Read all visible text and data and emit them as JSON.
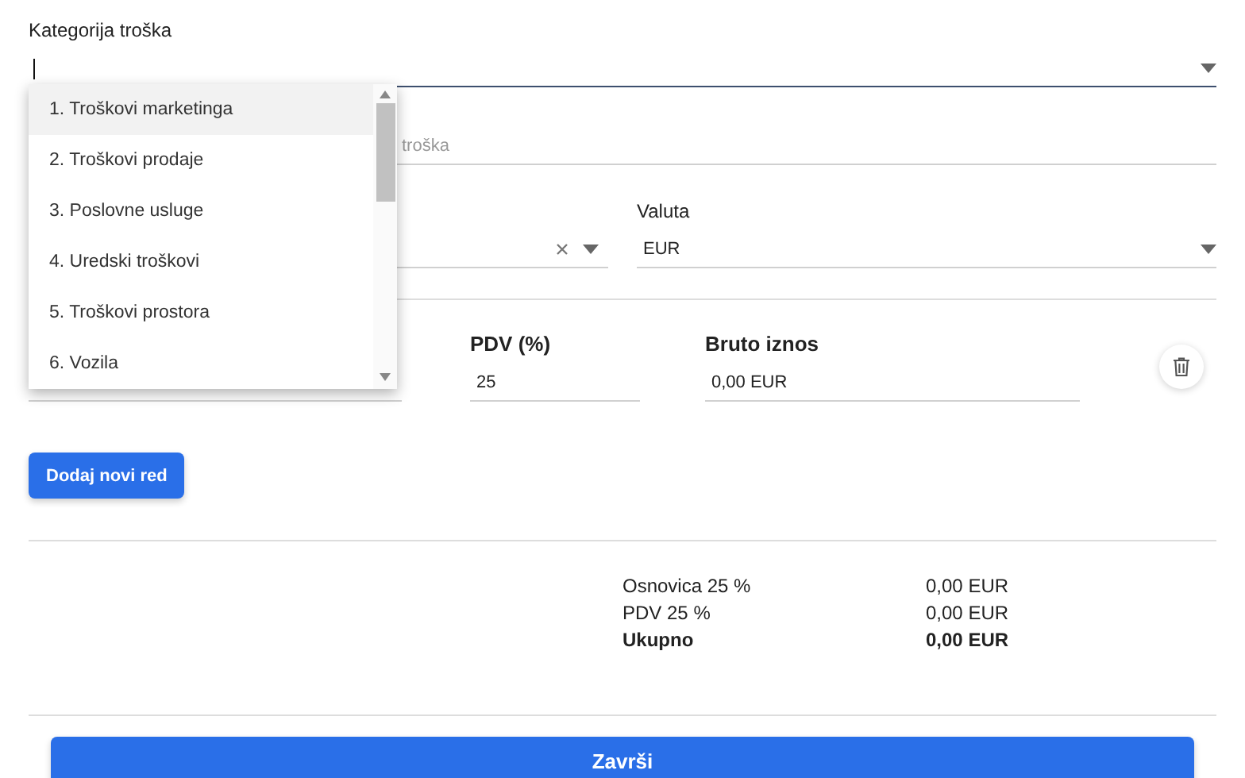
{
  "category": {
    "label": "Kategorija troška",
    "open": true,
    "options": [
      {
        "label": "1. Troškovi marketinga",
        "selected": true
      },
      {
        "label": "2. Troškovi prodaje",
        "selected": false
      },
      {
        "label": "3. Poslovne usluge",
        "selected": false
      },
      {
        "label": "4. Uredski troškovi",
        "selected": false
      },
      {
        "label": "5. Troškovi prostora",
        "selected": false
      },
      {
        "label": "6. Vozila",
        "selected": false
      }
    ]
  },
  "description": {
    "placeholder": "troška"
  },
  "currency": {
    "label": "Valuta",
    "value": "EUR"
  },
  "line_item": {
    "vat_label": "PDV (%)",
    "vat_value": "25",
    "gross_label": "Bruto iznos",
    "gross_value": "0,00 EUR"
  },
  "add_row_button": "Dodaj novi red",
  "summary": [
    {
      "label": "Osnovica 25 %",
      "value": "0,00 EUR",
      "bold": false
    },
    {
      "label": "PDV 25 %",
      "value": "0,00 EUR",
      "bold": false
    },
    {
      "label": "Ukupno",
      "value": "0,00 EUR",
      "bold": true
    }
  ],
  "finish_button": "Završi"
}
